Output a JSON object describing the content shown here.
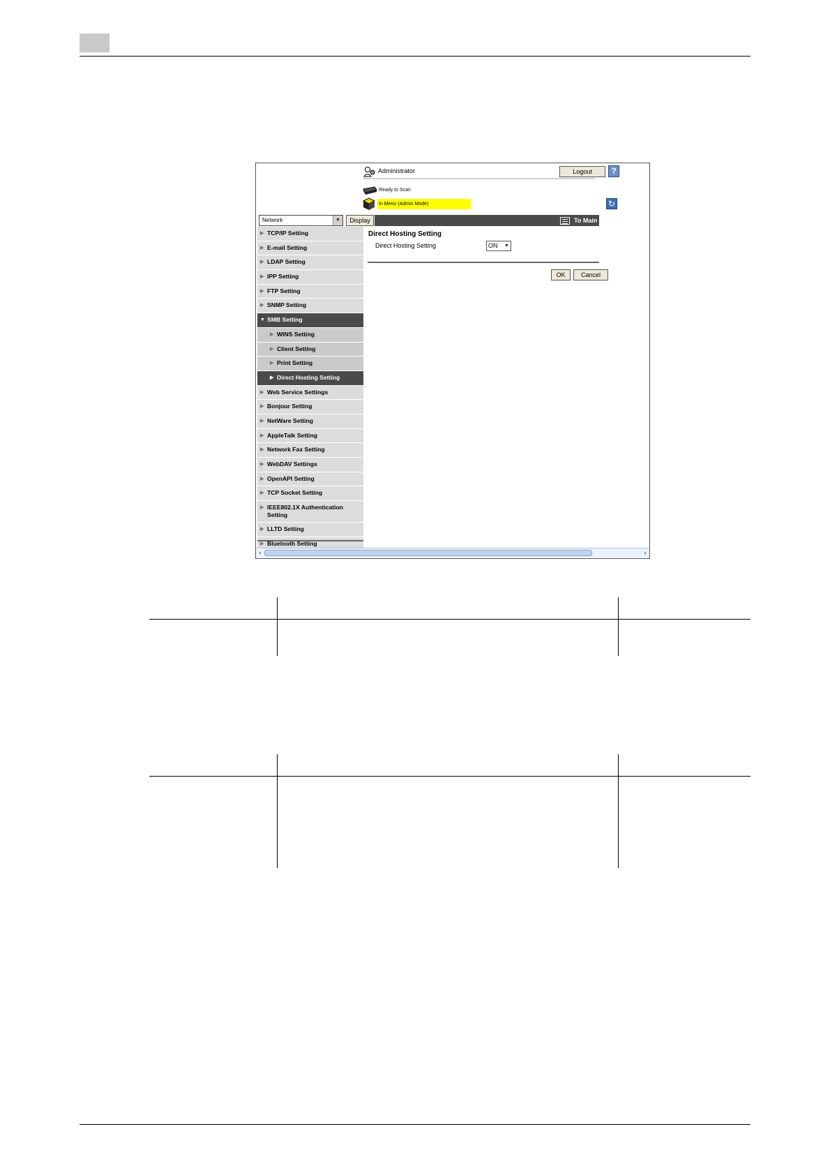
{
  "screen": {
    "user": {
      "label": "Administrator",
      "logout_label": "Logout",
      "help_symbol": "?"
    },
    "status": {
      "ready_text": "Ready to Scan",
      "mode_text": "In Menu (Admin Mode)"
    },
    "toolbar": {
      "category_value": "Network",
      "display_label": "Display",
      "main_menu_label": "To Main Menu"
    },
    "sidebar": {
      "items": [
        {
          "label": "TCP/IP Setting"
        },
        {
          "label": "E-mail Setting"
        },
        {
          "label": "LDAP Setting"
        },
        {
          "label": "IPP Setting"
        },
        {
          "label": "FTP Setting"
        },
        {
          "label": "SNMP Setting"
        },
        {
          "label": "SMB Setting"
        },
        {
          "label": "WINS Setting"
        },
        {
          "label": "Client Setting"
        },
        {
          "label": "Print Setting"
        },
        {
          "label": "Direct Hosting Setting"
        },
        {
          "label": "Web Service Settings"
        },
        {
          "label": "Bonjour Setting"
        },
        {
          "label": "NetWare Setting"
        },
        {
          "label": "AppleTalk Setting"
        },
        {
          "label": "Network Fax Setting"
        },
        {
          "label": "WebDAV Settings"
        },
        {
          "label": "OpenAPI Setting"
        },
        {
          "label": "TCP Socket Setting"
        },
        {
          "label": "IEEE802.1X Authentication Setting"
        },
        {
          "label": "LLTD Setting"
        },
        {
          "label": "Bluetooth Setting"
        }
      ]
    },
    "content": {
      "title": "Direct Hosting Setting",
      "field_label": "Direct Hosting Setting",
      "field_value": "ON",
      "ok_label": "OK",
      "cancel_label": "Cancel"
    }
  }
}
